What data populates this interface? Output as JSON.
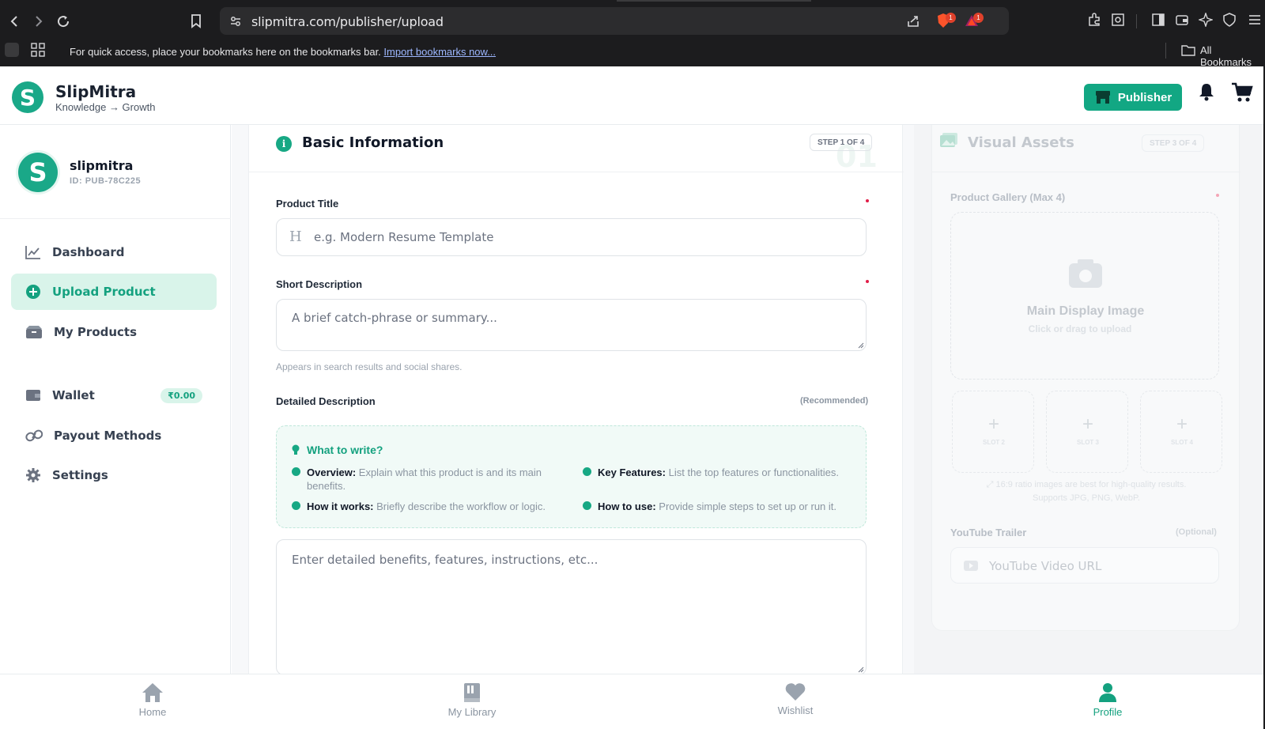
{
  "browser": {
    "url": "slipmitra.com/publisher/upload",
    "bookmarks_prompt": "For quick access, place your bookmarks here on the bookmarks bar.",
    "import_link": "Import bookmarks now...",
    "all_bookmarks": "All Bookmarks",
    "brave_badge_count": "1",
    "rewards_badge_count": "1"
  },
  "header": {
    "brand_name": "SlipMitra",
    "brand_tagline": "Knowledge → Growth",
    "publisher_label": "Publisher"
  },
  "sidebar": {
    "user_name": "slipmitra",
    "user_id": "ID: PUB-78C225",
    "items": [
      {
        "label": "Dashboard",
        "icon": "chart-line-icon",
        "active": false
      },
      {
        "label": "Upload Product",
        "icon": "plus-circle-icon",
        "active": true
      },
      {
        "label": "My Products",
        "icon": "boxes-icon",
        "active": false
      },
      {
        "label": "Wallet",
        "icon": "wallet-icon",
        "active": false,
        "badge": "₹0.00"
      },
      {
        "label": "Payout Methods",
        "icon": "link-icon",
        "active": false
      },
      {
        "label": "Settings",
        "icon": "gear-icon",
        "active": false
      }
    ]
  },
  "basic_info": {
    "title": "Basic Information",
    "step": "STEP 1 OF 4",
    "step_ghost": "01",
    "product_title_label": "Product Title",
    "product_title_placeholder": "e.g. Modern Resume Template",
    "short_desc_label": "Short Description",
    "short_desc_placeholder": "A brief catch-phrase or summary...",
    "short_desc_hint": "Appears in search results and social shares.",
    "detailed_desc_label": "Detailed Description",
    "detailed_desc_tag": "(Recommended)",
    "guide_title": "What to write?",
    "guide": [
      {
        "key": "Overview:",
        "value": "Explain what this product is and its main benefits."
      },
      {
        "key": "Key Features:",
        "value": "List the top features or functionalities."
      },
      {
        "key": "How it works:",
        "value": "Briefly describe the workflow or logic."
      },
      {
        "key": "How to use:",
        "value": "Provide simple steps to set up or run it."
      }
    ],
    "detailed_desc_placeholder": "Enter detailed benefits, features, instructions, etc..."
  },
  "visual_assets": {
    "title": "Visual Assets",
    "step": "STEP 3 OF 4",
    "gallery_label": "Product Gallery (Max 4)",
    "main_image_label": "Main Display Image",
    "main_image_hint": "Click or drag to upload",
    "slots": [
      "SLOT 2",
      "SLOT 3",
      "SLOT 4"
    ],
    "ratio_hint": "16:9 ratio images are best for high-quality results.",
    "formats_hint": "Supports JPG, PNG, WebP.",
    "youtube_label": "YouTube Trailer",
    "youtube_tag": "(Optional)",
    "youtube_placeholder": "YouTube Video URL"
  },
  "bottom_nav": [
    {
      "label": "Home",
      "icon": "home-icon",
      "active": false
    },
    {
      "label": "My Library",
      "icon": "library-icon",
      "active": false
    },
    {
      "label": "Wishlist",
      "icon": "heart-icon",
      "active": false
    },
    {
      "label": "Profile",
      "icon": "user-icon",
      "active": true
    }
  ],
  "colors": {
    "brand": "#17a884",
    "active_bg": "#d9f4ea",
    "chrome_bg": "#1c1c1e"
  }
}
